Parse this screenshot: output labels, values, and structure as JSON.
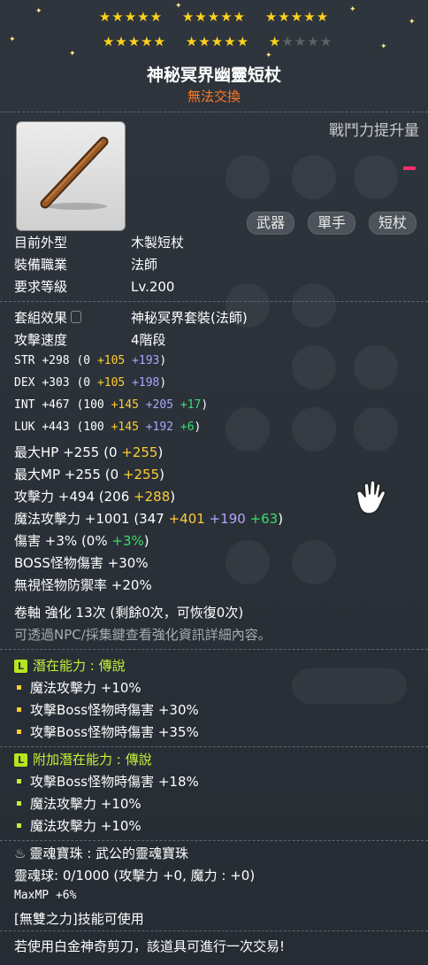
{
  "stars": {
    "row1": [
      "★★★★★",
      "★★★★★",
      "★★★★★"
    ],
    "row2_on": [
      "★★★★★",
      "★★★★★",
      "★"
    ],
    "row2_off": "★★★★"
  },
  "item": {
    "name": "神秘冥界幽靈短杖",
    "trade_status": "無法交換",
    "power_label": "戰鬥力提升量",
    "tags": [
      "武器",
      "單手",
      "短杖"
    ]
  },
  "info": [
    {
      "label": "目前外型",
      "value": "木製短杖"
    },
    {
      "label": "裝備職業",
      "value": "法師"
    },
    {
      "label": "要求等級",
      "value": "Lv.200"
    }
  ],
  "set": {
    "label": "套組效果",
    "value": "神秘冥界套裝(法師)"
  },
  "speed": {
    "label": "攻擊速度",
    "value": "4階段"
  },
  "stats": [
    {
      "name": "STR",
      "total": "+298",
      "base": "0",
      "flame": "+105",
      "star": "+193"
    },
    {
      "name": "DEX",
      "total": "+303",
      "base": "0",
      "flame": "+105",
      "star": "+198"
    },
    {
      "name": "INT",
      "total": "+467",
      "base": "100",
      "flame": "+145",
      "star": "+205",
      "scroll": "+17"
    },
    {
      "name": "LUK",
      "total": "+443",
      "base": "100",
      "flame": "+145",
      "star": "+192",
      "scroll": "+6"
    }
  ],
  "hp": {
    "label": "最大HP",
    "total": "+255",
    "base": "0",
    "flame": "+255"
  },
  "mp": {
    "label": "最大MP",
    "total": "+255",
    "base": "0",
    "flame": "+255"
  },
  "att": {
    "label": "攻擊力",
    "total": "+494",
    "base": "206",
    "flame": "+288"
  },
  "matt": {
    "label": "魔法攻擊力",
    "total": "+1001",
    "base": "347",
    "flame": "+401",
    "star": "+190",
    "scroll": "+63"
  },
  "dmg": {
    "label": "傷害",
    "total": "+3%",
    "base": "0%",
    "scroll": "+3%"
  },
  "boss": {
    "label": "BOSS怪物傷害",
    "value": "+30%"
  },
  "ied": {
    "label": "無視怪物防禦率",
    "value": "+20%"
  },
  "scroll_line": "卷軸 強化 13次 (剩餘0次，可恢復0次)",
  "hint": "可透過NPC/採集鍵查看強化資訊詳細內容。",
  "potential": {
    "badge": "L",
    "title": "潛在能力 : 傳說",
    "lines": [
      "魔法攻擊力 +10%",
      "攻擊Boss怪物時傷害 +30%",
      "攻擊Boss怪物時傷害 +35%"
    ]
  },
  "bonus": {
    "badge": "L",
    "title": "附加潛在能力 : 傳說",
    "lines": [
      "攻擊Boss怪物時傷害 +18%",
      "魔法攻擊力 +10%",
      "魔法攻擊力 +10%"
    ]
  },
  "soul": {
    "title": "靈魂寶珠 : 武公的靈魂寶珠",
    "gauge": "靈魂球: 0/1000 (攻擊力 +0, 魔力 : +0)",
    "stat": "MaxMP +6%"
  },
  "skill": "[無雙之力]技能可使用",
  "footer": "若使用白金神奇剪刀，該道具可進行一次交易!"
}
